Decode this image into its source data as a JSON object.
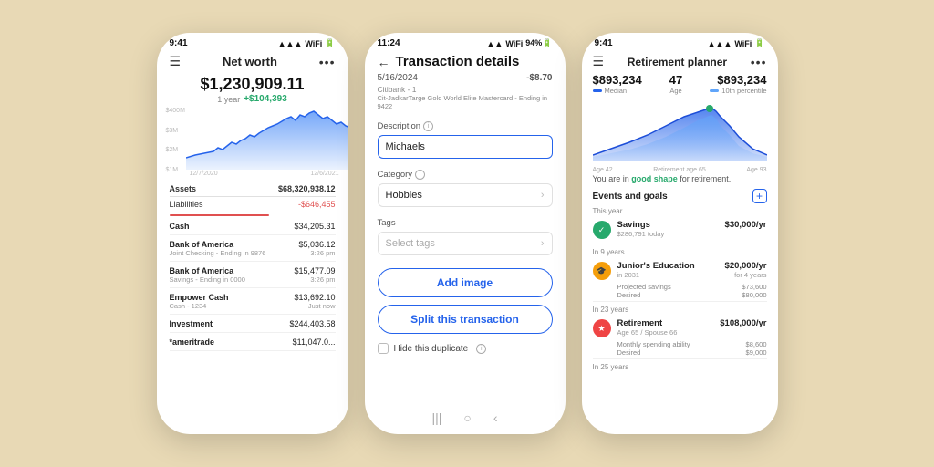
{
  "background": "#e8d9b5",
  "phones": {
    "left": {
      "status_time": "9:41",
      "title": "Net worth",
      "amount": "$1,230,909.11",
      "period": "1 year",
      "change": "+$104,393",
      "chart_labels_y": [
        "$400M",
        "$3M",
        "$2M",
        "$1M"
      ],
      "chart_dates": [
        "12/7/2020",
        "12/6/2021"
      ],
      "assets_label": "Assets",
      "assets_value": "$68,320,938.12",
      "liabilities_label": "Liabilities",
      "liabilities_value": "-$646,455",
      "accounts": [
        {
          "name": "Cash",
          "sub": "",
          "value": "$34,205.31",
          "time": ""
        },
        {
          "name": "Bank of America",
          "sub": "Joint Checking - Ending in 9876",
          "value": "$5,036.12",
          "time": "3:26 pm"
        },
        {
          "name": "Bank of America",
          "sub": "Savings - Ending in 0000",
          "value": "$15,477.09",
          "time": "3:26 pm"
        },
        {
          "name": "Empower Cash",
          "sub": "Cash - 1234",
          "value": "$13,692.10",
          "time": "Just now",
          "bold": true
        },
        {
          "name": "Investment",
          "sub": "",
          "value": "$244,403.58",
          "time": ""
        },
        {
          "name": "*ameritrade",
          "sub": "",
          "value": "$11,047.0...",
          "time": ""
        }
      ]
    },
    "middle": {
      "status_time": "11:24",
      "title": "Transaction details",
      "back_icon": "←",
      "date": "5/16/2024",
      "amount": "-$8.70",
      "account": "Citibank - 1",
      "account_sub": "Cit-JadkarTarge Gold World Elite Mastercard - Ending in 9422",
      "description_label": "Description",
      "description_value": "Michaels",
      "category_label": "Category",
      "category_value": "Hobbies",
      "tags_label": "Tags",
      "tags_placeholder": "Select tags",
      "btn_add_image": "Add image",
      "btn_split": "Split this transaction",
      "duplicate_label": "Hide this duplicate"
    },
    "right": {
      "status_time": "9:41",
      "title": "Retirement planner",
      "stat1_value": "$893,234",
      "stat1_label": "Median",
      "stat_age_value": "47",
      "stat_age_label": "Age",
      "stat2_value": "$893,234",
      "stat2_label": "10th percentile",
      "chart_labels": [
        "Age 42",
        "Retirement age 65",
        "Age 93"
      ],
      "status_text_prefix": "You are in ",
      "status_highlight": "good shape",
      "status_text_suffix": " for retirement.",
      "events_title": "Events and goals",
      "periods": [
        {
          "label": "This year",
          "goals": [
            {
              "name": "Savings",
              "sub": "$286,791 today",
              "amount": "$30,000/yr",
              "period": "",
              "icon_type": "green",
              "icon": "✓"
            }
          ]
        },
        {
          "label": "In 9 years",
          "goals": [
            {
              "name": "Junior's Education",
              "sub": "in 2031",
              "amount": "$20,000/yr",
              "period": "for 4 years",
              "icon_type": "orange",
              "icon": "🎓",
              "details": [
                {
                  "label": "Projected savings",
                  "value": "$73,600"
                },
                {
                  "label": "Desired",
                  "value": "$80,000"
                }
              ]
            }
          ]
        },
        {
          "label": "In 23 years",
          "goals": [
            {
              "name": "Retirement",
              "sub": "Age 65 / Spouse 66",
              "amount": "$108,000/yr",
              "period": "",
              "icon_type": "red",
              "icon": "⚑",
              "details": [
                {
                  "label": "Monthly spending ability",
                  "value": "$8,600"
                },
                {
                  "label": "Desired",
                  "value": "$9,000"
                }
              ]
            }
          ]
        },
        {
          "label": "In 25 years",
          "goals": []
        }
      ]
    }
  }
}
